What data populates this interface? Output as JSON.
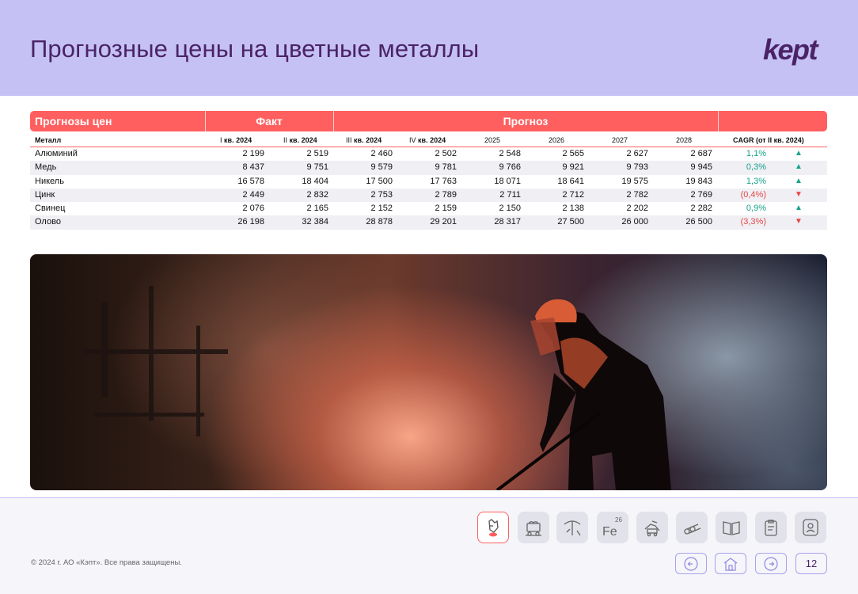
{
  "header": {
    "title": "Прогнозные цены на цветные металлы",
    "logo": "kept"
  },
  "table": {
    "band": {
      "section_label": "Прогнозы цен",
      "fact_label": "Факт",
      "forecast_label": "Прогноз"
    },
    "columns": {
      "metal": "Металл",
      "q1_roman": "I",
      "q1_rest": "кв. 2024",
      "q2_roman": "II",
      "q2_rest": "кв. 2024",
      "q3_roman": "III",
      "q3_rest": "кв. 2024",
      "q4_roman": "IV",
      "q4_rest": "кв. 2024",
      "y2025": "2025",
      "y2026": "2026",
      "y2027": "2027",
      "y2028": "2028",
      "cagr": "CAGR (от II кв. 2024)"
    },
    "rows": [
      {
        "metal": "Алюминий",
        "q1": "2 199",
        "q2": "2 519",
        "q3": "2 460",
        "q4": "2 502",
        "y2025": "2 548",
        "y2026": "2 565",
        "y2027": "2 627",
        "y2028": "2 687",
        "cagr": "1,1%",
        "trend": "▲"
      },
      {
        "metal": "Медь",
        "q1": "8 437",
        "q2": "9 751",
        "q3": "9 579",
        "q4": "9 781",
        "y2025": "9 766",
        "y2026": "9 921",
        "y2027": "9 793",
        "y2028": "9 945",
        "cagr": "0,3%",
        "trend": "▲"
      },
      {
        "metal": "Никель",
        "q1": "16 578",
        "q2": "18 404",
        "q3": "17 500",
        "q4": "17 763",
        "y2025": "18 071",
        "y2026": "18 641",
        "y2027": "19 575",
        "y2028": "19 843",
        "cagr": "1,3%",
        "trend": "▲"
      },
      {
        "metal": "Цинк",
        "q1": "2 449",
        "q2": "2 832",
        "q3": "2 753",
        "q4": "2 789",
        "y2025": "2 711",
        "y2026": "2 712",
        "y2027": "2 782",
        "y2028": "2 769",
        "cagr": "(0,4%)",
        "trend": "▼"
      },
      {
        "metal": "Свинец",
        "q1": "2 076",
        "q2": "2 165",
        "q3": "2 152",
        "q4": "2 159",
        "y2025": "2 150",
        "y2026": "2 138",
        "y2027": "2 202",
        "y2028": "2 282",
        "cagr": "0,9%",
        "trend": "▲"
      },
      {
        "metal": "Олово",
        "q1": "26 198",
        "q2": "32 384",
        "q3": "28 878",
        "q4": "29 201",
        "y2025": "28 317",
        "y2026": "27 500",
        "y2027": "26 000",
        "y2028": "26 500",
        "cagr": "(3,3%)",
        "trend": "▼"
      }
    ]
  },
  "colors": {
    "header_bg": "#c5c1f5",
    "title": "#4a2367",
    "table_band": "#ff5f5f",
    "positive": "#16a38a",
    "negative": "#e64646",
    "footer_bg": "#f5f5fa"
  },
  "footer": {
    "copyright": "© 2024 г. АО «Кэпт». Все права защищены.",
    "fe_symbol": "Fe",
    "fe_number": "26",
    "page_number": "12",
    "icons": [
      "hand-drop-icon",
      "mining-cart-icon",
      "pickaxe-icon",
      "fe-element-icon",
      "machinery-icon",
      "logs-icon",
      "book-icon",
      "clipboard-icon",
      "person-icon"
    ],
    "nav_icons": [
      "arrow-left-icon",
      "home-icon",
      "arrow-right-icon"
    ]
  }
}
